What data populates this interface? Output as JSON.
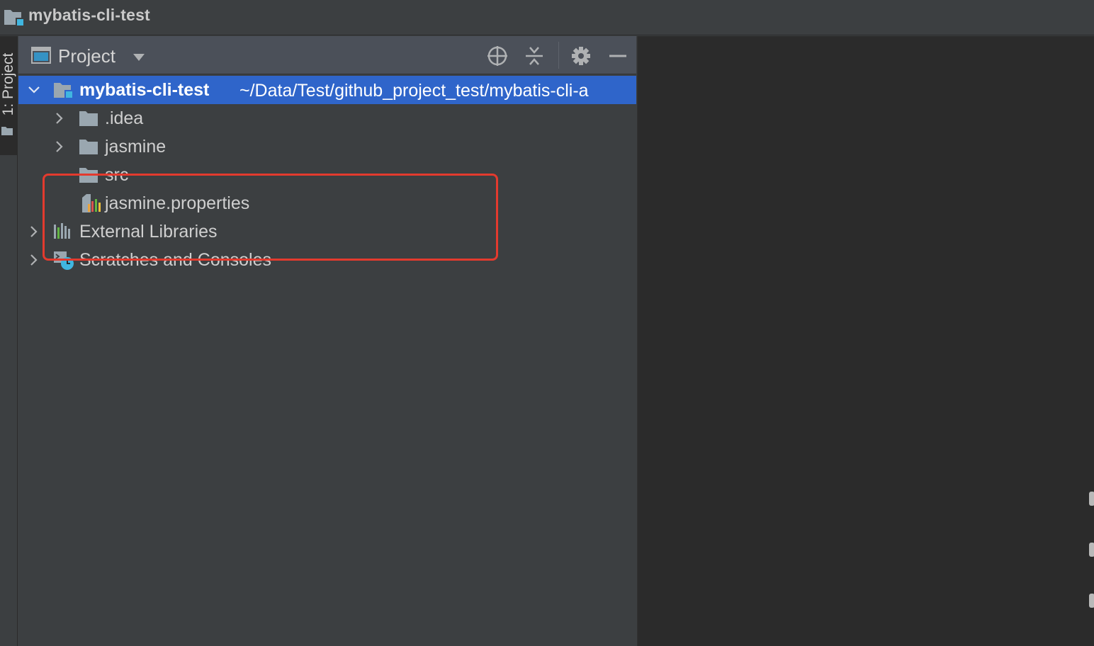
{
  "window": {
    "title": "mybatis-cli-test"
  },
  "tool_stripe": {
    "tab_label": "1: Project"
  },
  "project_panel": {
    "view_label": "Project",
    "toolbar_icons": [
      "locate-icon",
      "collapse-all-icon",
      "settings-gear-icon",
      "hide-minimize-icon"
    ]
  },
  "tree": {
    "root": {
      "name": "mybatis-cli-test",
      "path": "~/Data/Test/github_project_test/mybatis-cli-a"
    },
    "children": [
      {
        "label": ".idea",
        "type": "folder",
        "expandable": true
      },
      {
        "label": "jasmine",
        "type": "folder",
        "expandable": true
      },
      {
        "label": "src",
        "type": "folder",
        "expandable": false
      },
      {
        "label": "jasmine.properties",
        "type": "properties-file",
        "expandable": false
      }
    ],
    "extras": [
      {
        "label": "External Libraries",
        "type": "libraries",
        "expandable": true
      },
      {
        "label": "Scratches and Consoles",
        "type": "scratches",
        "expandable": true
      }
    ]
  },
  "colors": {
    "selection": "#2f65ca",
    "annotation_box": "#e33a2e",
    "panel_bg": "#3c3f41",
    "editor_bg": "#2b2b2b"
  }
}
